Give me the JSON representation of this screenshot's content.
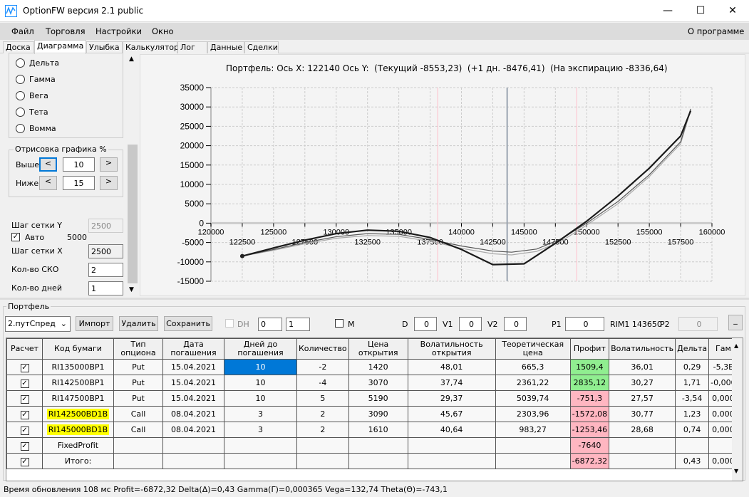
{
  "window": {
    "title": "OptionFW версия 2.1 public",
    "minimize": "—",
    "maximize": "☐",
    "close": "✕"
  },
  "menu": {
    "items": [
      "Файл",
      "Торговля",
      "Настройки",
      "Окно"
    ],
    "about": "О программе"
  },
  "tabs": [
    "Доска",
    "Диаграмма",
    "Улыбка",
    "Калькулятор",
    "Лог",
    "Данные",
    "Сделки"
  ],
  "left": {
    "radios": [
      "Дельта",
      "Гамма",
      "Вега",
      "Тета",
      "Вомма"
    ],
    "draw_group": "Отрисовка графика %",
    "above_label": "Выше",
    "above_value": "10",
    "below_label": "Ниже",
    "below_value": "15",
    "prev": "<",
    "next": ">",
    "grid_y_label": "Шаг сетки Y",
    "grid_y_value": "2500",
    "auto_label": "Авто",
    "auto_value": "5000",
    "grid_x_label": "Шаг сетки X",
    "grid_x_value": "2500",
    "sko_label": "Кол-во СКО",
    "sko_value": "2",
    "days_label": "Кол-во дней",
    "days_value": "1"
  },
  "chart_data": {
    "type": "line",
    "title": "Портфель: Ось X: 122140 Ось Y:  (Текущий -8553,23)  (+1 дн. -8476,41)  (На экспирацию -8336,64)",
    "xlim": [
      120000,
      160000
    ],
    "ylim": [
      -15000,
      35000
    ],
    "x_ticks_top": [
      "120000",
      "125000",
      "130000",
      "135000",
      "140000",
      "145000",
      "150000",
      "155000",
      "160000"
    ],
    "x_ticks_bottom": [
      "122500",
      "127500",
      "132500",
      "137500",
      "142500",
      "147500",
      "152500",
      "157500"
    ],
    "y_ticks": [
      "35000",
      "30000",
      "25000",
      "20000",
      "15000",
      "10000",
      "5000",
      "0",
      "-5000",
      "-10000",
      "-15000"
    ],
    "current_price": 143650,
    "sd_lines": [
      138100,
      149200
    ],
    "series": [
      {
        "name": "На экспирацию",
        "color": "#1a1a1a",
        "points": [
          [
            122500,
            -8500
          ],
          [
            125000,
            -6400
          ],
          [
            127500,
            -4400
          ],
          [
            130000,
            -2700
          ],
          [
            132500,
            -1800
          ],
          [
            135000,
            -2100
          ],
          [
            137500,
            -3700
          ],
          [
            140000,
            -6800
          ],
          [
            142500,
            -10700
          ],
          [
            145000,
            -10500
          ],
          [
            147500,
            -5200
          ],
          [
            150000,
            500
          ],
          [
            152500,
            7000
          ],
          [
            155000,
            14200
          ],
          [
            157500,
            22500
          ],
          [
            158300,
            29000
          ]
        ]
      },
      {
        "name": "Текущий",
        "color": "#555555",
        "points": [
          [
            122500,
            -8500
          ],
          [
            125000,
            -6800
          ],
          [
            127500,
            -5000
          ],
          [
            130000,
            -3500
          ],
          [
            132500,
            -2700
          ],
          [
            135000,
            -2900
          ],
          [
            137500,
            -4200
          ],
          [
            140000,
            -5900
          ],
          [
            142500,
            -7200
          ],
          [
            144000,
            -7500
          ],
          [
            146000,
            -6700
          ],
          [
            148000,
            -4000
          ],
          [
            150000,
            0
          ],
          [
            152500,
            5600
          ],
          [
            155000,
            12500
          ],
          [
            157500,
            21000
          ],
          [
            158300,
            29500
          ]
        ]
      },
      {
        "name": "+1 дн.",
        "color": "#aaaaaa",
        "points": [
          [
            122500,
            -8500
          ],
          [
            125000,
            -7000
          ],
          [
            127500,
            -5300
          ],
          [
            130000,
            -3900
          ],
          [
            132500,
            -3200
          ],
          [
            135000,
            -3400
          ],
          [
            137500,
            -4700
          ],
          [
            140000,
            -6500
          ],
          [
            142500,
            -7900
          ],
          [
            144000,
            -8200
          ],
          [
            146000,
            -7300
          ],
          [
            148000,
            -4600
          ],
          [
            150000,
            -500
          ],
          [
            152500,
            5000
          ],
          [
            155000,
            12000
          ],
          [
            157500,
            20500
          ],
          [
            158300,
            29200
          ]
        ]
      }
    ]
  },
  "portfolio": {
    "label": "Портфель",
    "selected": "2.путСпред",
    "import": "Импорт",
    "delete": "Удалить",
    "save": "Сохранить",
    "dh": "DH",
    "spin1": "0",
    "spin2": "1",
    "m": "M",
    "d_label": "D",
    "d": "0",
    "v1_label": "V1",
    "v1": "0",
    "v2_label": "V2",
    "v2": "0",
    "p1_label": "P1",
    "p1": "0",
    "rim": "RIM1 143650",
    "p2_label": "P2",
    "p2": "0",
    "small": "_"
  },
  "table": {
    "headers": [
      "Расчет",
      "Код бумаги",
      "Тип опциона",
      "Дата погашения",
      "Дней до погашения",
      "Количество",
      "Цена открытия",
      "Волатильность открытия",
      "Теоретическая цена",
      "Профит",
      "Волатильность",
      "Дельта",
      "Гам"
    ],
    "rows": [
      [
        "✓",
        "RI135000BP1",
        "Put",
        "15.04.2021",
        "10",
        "-2",
        "1420",
        "48,01",
        "665,3",
        "1509,4",
        "36,01",
        "0,29",
        "-5,3E"
      ],
      [
        "✓",
        "RI142500BP1",
        "Put",
        "15.04.2021",
        "10",
        "-4",
        "3070",
        "37,74",
        "2361,22",
        "2835,12",
        "30,27",
        "1,71",
        "-0,000"
      ],
      [
        "✓",
        "RI147500BP1",
        "Put",
        "15.04.2021",
        "10",
        "5",
        "5190",
        "29,37",
        "5039,74",
        "-751,3",
        "27,57",
        "-3,54",
        "0,000"
      ],
      [
        "✓",
        "RI142500BD1B",
        "Call",
        "08.04.2021",
        "3",
        "2",
        "3090",
        "45,67",
        "2303,96",
        "-1572,08",
        "30,77",
        "1,23",
        "0,000"
      ],
      [
        "✓",
        "RI145000BD1B",
        "Call",
        "08.04.2021",
        "3",
        "2",
        "1610",
        "40,64",
        "983,27",
        "-1253,46",
        "28,68",
        "0,74",
        "0,000"
      ],
      [
        "✓",
        "FixedProfit",
        "",
        "",
        "",
        "",
        "",
        "",
        "",
        "-7640",
        "",
        "",
        ""
      ],
      [
        "✓",
        "Итого:",
        "",
        "",
        "",
        "",
        "",
        "",
        "",
        "-6872,32",
        "",
        "0,43",
        "0,000"
      ]
    ],
    "profit_colors": [
      "green",
      "green",
      "pink",
      "pink",
      "pink",
      "pink",
      "pink"
    ],
    "highlight_rows": [
      3,
      4
    ]
  },
  "status": "Время обновления 108 мс  Profit=-6872,32 Delta(Δ)=0,43 Gamma(Γ)=0,000365 Vega=132,74 Theta(Θ)=-743,1"
}
